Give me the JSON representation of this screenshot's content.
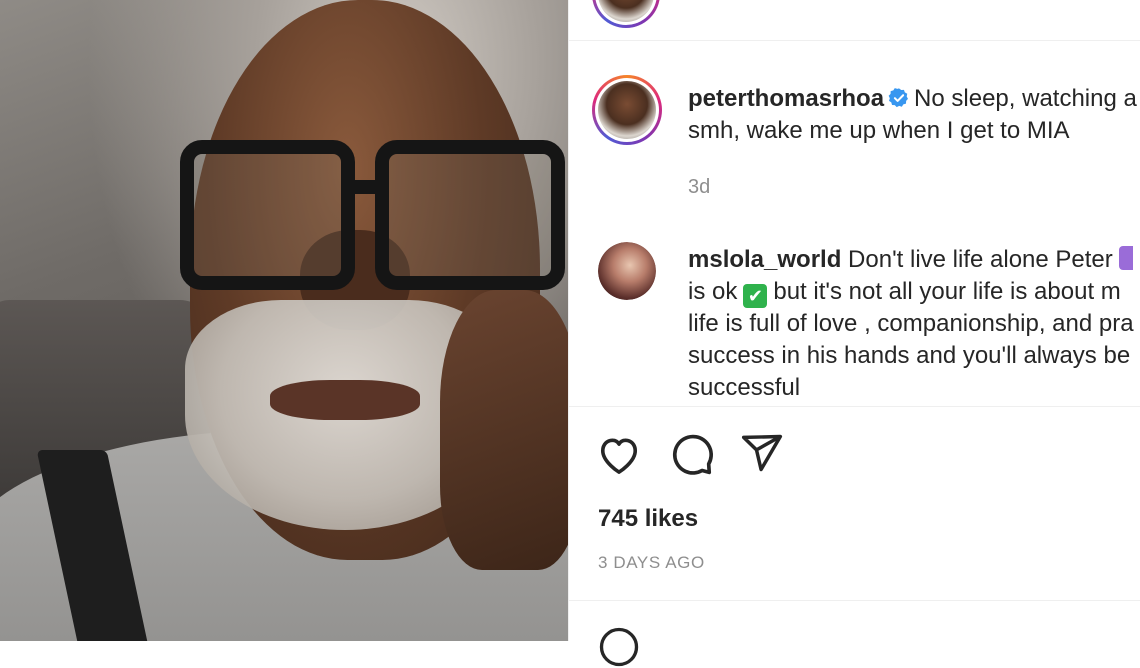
{
  "post": {
    "author": {
      "username": "peterthomasrhoa",
      "verified": true,
      "caption_line1": "No sleep, watching a",
      "caption_line2": "smh, wake me up when I get to MIA",
      "time": "3d"
    },
    "comment": {
      "username": "mslola_world",
      "line1": "Don't live life alone Peter",
      "line2_part1": "is ok",
      "line2_emoji": "✔",
      "line2_part2": "but it's not all your life is about m",
      "line3": "life is full of love , companionship, and pra",
      "line4": "success in his hands and you'll always be",
      "line5": "successful"
    },
    "actions": {
      "like_icon": "heart-icon",
      "comment_icon": "comment-icon",
      "share_icon": "share-icon"
    },
    "likes": "745 likes",
    "posted": "3 DAYS AGO"
  },
  "colors": {
    "verified": "#3897f0",
    "text": "#262626",
    "muted": "#8e8e8e",
    "divider": "#efefef"
  }
}
